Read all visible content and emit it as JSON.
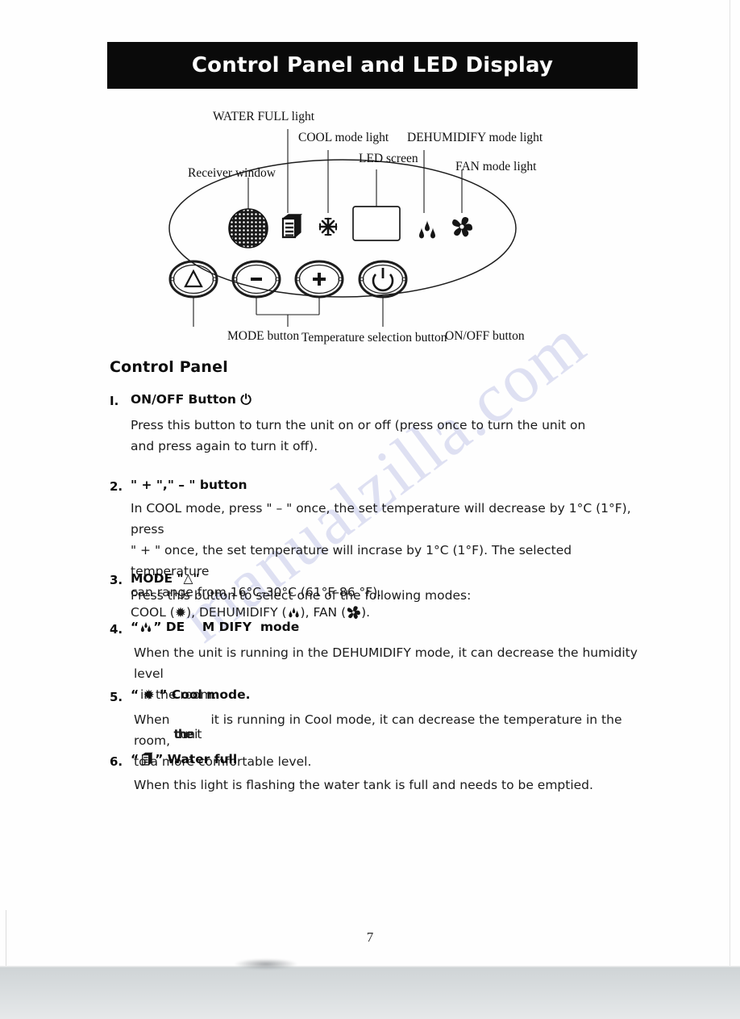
{
  "header": {
    "title": "Control Panel and LED Display"
  },
  "watermark": {
    "text": "manualzilla.com"
  },
  "diagram": {
    "labels": {
      "water_full": "WATER FULL light",
      "cool_mode": "COOL mode light",
      "dehumidify_mode": "DEHUMIDIFY mode light",
      "led_screen": "LED screen",
      "fan_mode": "FAN mode light",
      "receiver_window": "Receiver window",
      "mode_button": "MODE button",
      "temperature_button": "Temperature selection button",
      "onoff_button": "ON/OFF button"
    },
    "buttons": {
      "mode_glyph": "△",
      "minus_glyph": "–",
      "plus_glyph": "+",
      "power_glyph": "⏻"
    }
  },
  "section": {
    "title": "Control Panel"
  },
  "items": [
    {
      "number": "I.",
      "heading_prefix": "ON/OFF  Button",
      "heading_symbol": "⏻",
      "body": "Press this button to turn the unit on or off (press once to turn the unit on and press again to turn it off)."
    },
    {
      "number": "2.",
      "heading": "\" + \",\" – \" button",
      "body_line1": "In COOL mode, press \" – \" once, the set temperature will decrease by 1°C (1°F), press",
      "body_line2": "\" + \" once, the set temperature will incrase by 1°C (1°F). The selected temperature",
      "body_line3": "can range from 16°C-30°C (61°F-86 °F)."
    },
    {
      "number": "3.",
      "heading": "MODE \"△\"",
      "body_line1": "Press this button to select one of the following modes:",
      "body_line2_a": "COOL (",
      "body_line2_cool_symbol": "✹",
      "body_line2_b": "),  DEHUMIDIFY (",
      "body_line2_dehum_symbol": "☲",
      "body_line2_c": "), FAN (",
      "body_line2_fan_symbol": "✸",
      "body_line2_d": ")."
    },
    {
      "number": "4.",
      "heading_open_quote": "“",
      "heading_symbol": "dehumidify-droplets-icon",
      "heading_close_quote": "”",
      "heading_text": "DE    M DIFY  mode",
      "body_line1": "When the unit is running in the DEHUMIDIFY mode, it can decrease the humidity level",
      "body_line2": "in the room."
    },
    {
      "number": "5.",
      "heading_open_quote": "“",
      "heading_symbol": "✹",
      "heading_close_quote": "”",
      "heading_text": "Cool mode.",
      "body_prefix": "When ",
      "body_artifact_a": "the",
      "body_artifact_b": "unit",
      "body_line1_rest": "it is running in Cool mode, it can decrease the temperature in the room,",
      "body_line2": "to a more comfortable level."
    },
    {
      "number": "6.",
      "heading_open_quote": "“",
      "heading_symbol": "water-full-icon",
      "heading_close_quote": "”",
      "heading_text": "Water full",
      "body_line1": "When this light is flashing the water tank is full and needs to be emptied."
    }
  ],
  "footer": {
    "page_number": "7"
  }
}
